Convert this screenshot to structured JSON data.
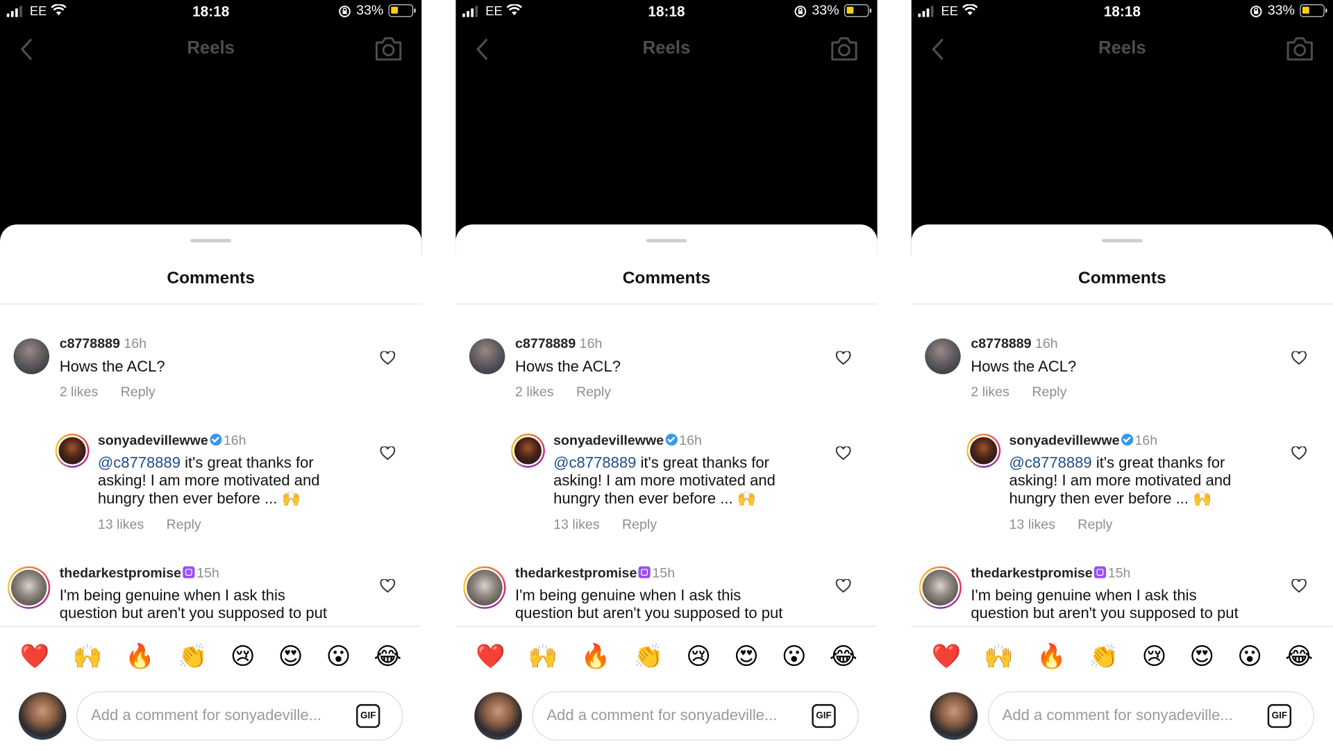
{
  "status_bar": {
    "carrier": "EE",
    "time": "18:18",
    "battery_percent": "33%",
    "battery_level": 0.33
  },
  "header": {
    "title": "Reels",
    "back_icon": "chevron-left-icon",
    "camera_icon": "camera-icon"
  },
  "sheet": {
    "title": "Comments"
  },
  "comments": [
    {
      "username": "c8778889",
      "time": "16h",
      "text": "Hows the ACL?",
      "likes": "2 likes",
      "reply": "Reply"
    },
    {
      "username": "sonyadevillewwe",
      "time": "16h",
      "verified": true,
      "mention": "@c8778889",
      "text_line1": " it's great thanks for",
      "text_line2": "asking! I am more motivated and",
      "text_line3": "hungry then ever before ... ",
      "emoji": "🙌",
      "likes": "13 likes",
      "reply": "Reply"
    },
    {
      "username": "thedarkestpromise",
      "time": "15h",
      "subscriber_badge": true,
      "text_line1": "I'm being genuine when I ask this",
      "text_line2": "question but aren't you supposed to put"
    }
  ],
  "reactions": [
    "❤️",
    "🙌",
    "🔥",
    "👏",
    "😢",
    "😍",
    "😮",
    "😂"
  ],
  "composer": {
    "placeholder": "Add a comment for sonyadeville...",
    "gif_label": "GIF"
  },
  "colors": {
    "mention": "#1e4b8a",
    "verified": "#3897f0",
    "subscriber_badge": "#9c4df2",
    "battery": "#f5d40f"
  }
}
